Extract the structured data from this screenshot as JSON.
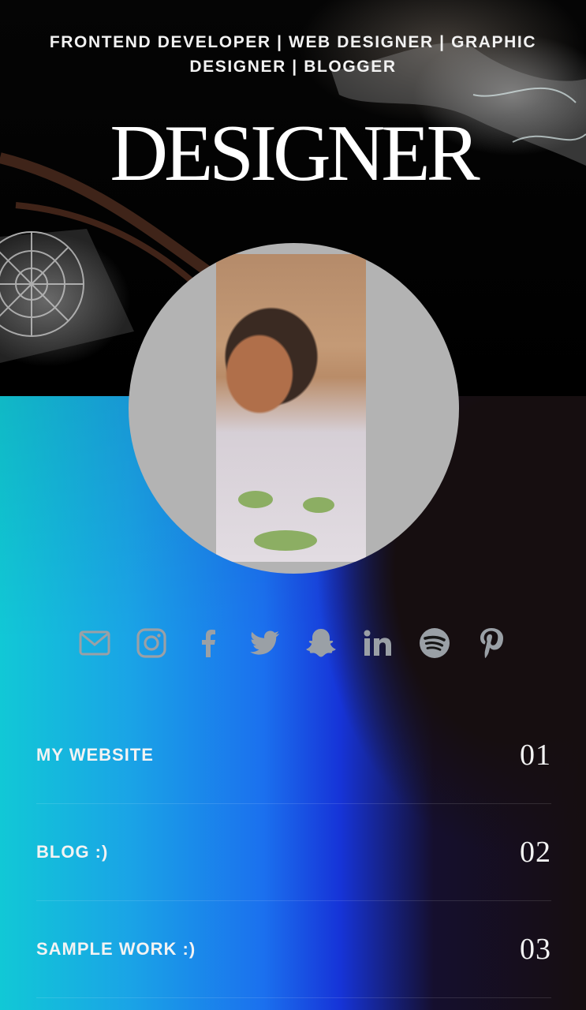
{
  "header": {
    "tagline": "FRONTEND DEVELOPER | WEB DESIGNER | GRAPHIC DESIGNER | BLOGGER",
    "title": "DESIGNER"
  },
  "profile": {
    "avatar_icon": "profile-photo"
  },
  "social": [
    {
      "name": "mail-icon",
      "label": "email"
    },
    {
      "name": "instagram-icon",
      "label": "instagram"
    },
    {
      "name": "facebook-icon",
      "label": "facebook"
    },
    {
      "name": "twitter-icon",
      "label": "twitter"
    },
    {
      "name": "snapchat-icon",
      "label": "snapchat"
    },
    {
      "name": "linkedin-icon",
      "label": "linkedin"
    },
    {
      "name": "spotify-icon",
      "label": "spotify"
    },
    {
      "name": "pinterest-icon",
      "label": "pinterest"
    }
  ],
  "links": [
    {
      "label": "MY WEBSITE",
      "number": "01"
    },
    {
      "label": "BLOG :)",
      "number": "02"
    },
    {
      "label": "SAMPLE WORK :)",
      "number": "03"
    }
  ],
  "colors": {
    "icon": "#9aa0a6",
    "text": "#f3f3f3",
    "avatar_bg": "#b3b3b3",
    "gradient_left": "#11c8d6",
    "gradient_mid": "#1b70ee",
    "dark": "#160e10"
  }
}
